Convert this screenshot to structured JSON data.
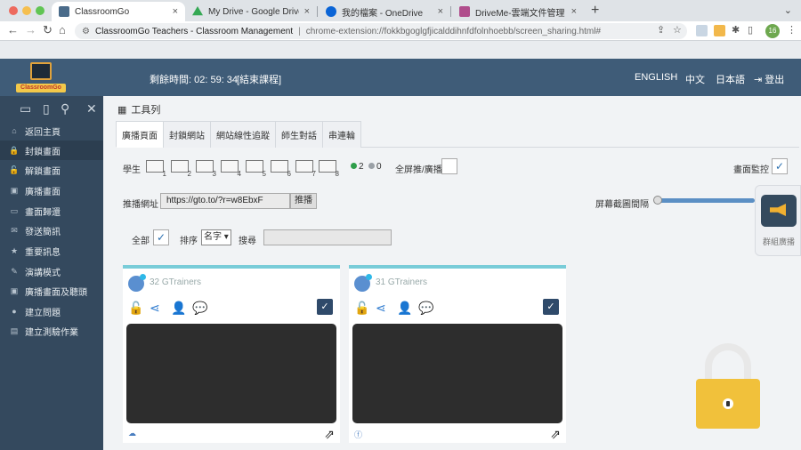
{
  "browser": {
    "tabs": [
      {
        "label": "ClassroomGo",
        "favicon_color": "#4a6b8a",
        "active": true
      },
      {
        "label": "My Drive - Google Drive",
        "favicon_color": "#34a853",
        "active": false
      },
      {
        "label": "我的檔案 - OneDrive",
        "favicon_color": "#0a64d6",
        "active": false
      },
      {
        "label": "DriveMe-雲端文件管理",
        "favicon_color": "#b04d8c",
        "active": false
      }
    ],
    "close_glyph": "×",
    "new_tab": "+",
    "tab_menu": "⌄",
    "address": {
      "site": "ClassroomGo Teachers - Classroom Management",
      "url": "chrome-extension://fokkbgoglgfjicalddihnfdfolnhoebb/screen_sharing.html#"
    },
    "profile_initials": "16"
  },
  "header": {
    "logo_text": "ClassroomGo",
    "timer": "剩餘時間: 02: 59: 34",
    "end_class": "[結束課程]",
    "lang_en": "ENGLISH",
    "lang_zh": "中文",
    "lang_ja": "日本語",
    "logout": "登出"
  },
  "sidebar": {
    "items": [
      {
        "label": "返回主頁",
        "icon": "home-icon",
        "glyph": "⌂"
      },
      {
        "label": "封鎖畫面",
        "icon": "lock-icon",
        "glyph": "🔒"
      },
      {
        "label": "解鎖畫面",
        "icon": "unlock-icon",
        "glyph": "🔓"
      },
      {
        "label": "廣播畫面",
        "icon": "broadcast-icon",
        "glyph": "▣"
      },
      {
        "label": "畫面歸還",
        "icon": "screen-return-icon",
        "glyph": "▭"
      },
      {
        "label": "發送簡訊",
        "icon": "message-icon",
        "glyph": "✉"
      },
      {
        "label": "重要訊息",
        "icon": "star-icon",
        "glyph": "★"
      },
      {
        "label": "演講模式",
        "icon": "pen-icon",
        "glyph": "✎"
      },
      {
        "label": "廣播畫面及聽頭",
        "icon": "broadcast-audio-icon",
        "glyph": "▣"
      },
      {
        "label": "建立問題",
        "icon": "question-icon",
        "glyph": "●"
      },
      {
        "label": "建立測驗作業",
        "icon": "document-icon",
        "glyph": "▤"
      }
    ]
  },
  "toolbar": {
    "title": "工具列",
    "tabs": [
      "廣播頁面",
      "封鎖網站",
      "網站線性追蹤",
      "師生對話",
      "串連輪"
    ]
  },
  "controls": {
    "students_label": "學生",
    "layouts": [
      "1",
      "2",
      "3",
      "4",
      "5",
      "6",
      "7",
      "8"
    ],
    "online_count": "2",
    "offline_count": "0",
    "fullscreen_label": "全屏推/廣播",
    "monitor_label": "畫面監控",
    "push_url_label": "推播網址",
    "push_url_value": "https://gto.to/?r=w8EbxF",
    "push_button": "推播",
    "interval_label": "屏幕截圖間隔",
    "all_label": "全部",
    "sort_label": "排序",
    "sort_value": "名字",
    "search_label": "搜尋",
    "group_broadcast": "群組廣播",
    "checkmark": "✓"
  },
  "students": [
    {
      "name": "32 GTrainers",
      "footer_icon": "cloud-icon",
      "footer_glyph": "☁"
    },
    {
      "name": "31 GTrainers",
      "footer_icon": "facebook-icon",
      "footer_glyph": "ⓕ"
    }
  ],
  "colors": {
    "header_bg": "#3f5c78",
    "sidebar_bg": "#34495e",
    "card_accent": "#79ccd8",
    "lock_yellow": "#f1c13b",
    "online_dot": "#2e9e4a"
  }
}
